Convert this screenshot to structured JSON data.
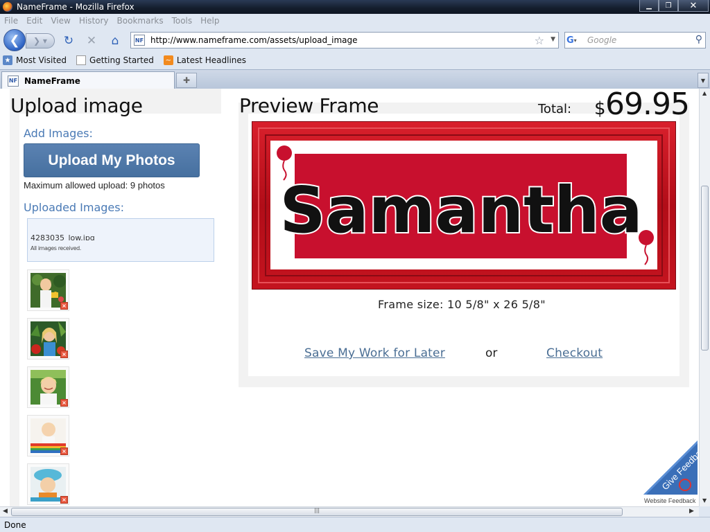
{
  "window": {
    "title": "NameFrame - Mozilla Firefox",
    "controls": {
      "minimize": "▁",
      "maximize": "❐",
      "close": "✕"
    }
  },
  "menu": [
    "File",
    "Edit",
    "View",
    "History",
    "Bookmarks",
    "Tools",
    "Help"
  ],
  "navigation": {
    "url": "http://www.nameframe.com/assets/upload_image",
    "search_placeholder": "Google",
    "favicon_text": "NF"
  },
  "bookmarks": [
    "Most Visited",
    "Getting Started",
    "Latest Headlines"
  ],
  "tabs": [
    {
      "label": "NameFrame",
      "active": true
    }
  ],
  "status": "Done",
  "upload_panel": {
    "title": "Upload image",
    "add_images_label": "Add Images:",
    "upload_button": "Upload My Photos",
    "max_note": "Maximum allowed upload: 9 photos",
    "uploaded_label": "Uploaded Images:",
    "upload_status": {
      "filename": "4283035_low.jpg",
      "message": "All images received."
    },
    "thumbnails": [
      {
        "description": "girl-watering-flowers"
      },
      {
        "description": "girl-with-flowers"
      },
      {
        "description": "smiling-girl-green"
      },
      {
        "description": "toddler-on-stripes"
      },
      {
        "description": "child-blue-hat"
      }
    ],
    "delete_icon": "×"
  },
  "preview_panel": {
    "title": "Preview Frame",
    "total_label": "Total:",
    "currency": "$",
    "total_amount": "69.95",
    "frame_name_text": "Samantha",
    "frame_size": "Frame size: 10 5/8\" x 26 5/8\"",
    "save_link": "Save My Work for Later",
    "or_text": "or",
    "checkout_link": "Checkout"
  },
  "feedback": {
    "label": "Give Feedback",
    "caption": "Website Feedback"
  },
  "colors": {
    "frame_red": "#c8102e",
    "link_blue": "#4a6e94",
    "accent_blue": "#4a7ab5",
    "button_blue": "#4f78a8"
  }
}
